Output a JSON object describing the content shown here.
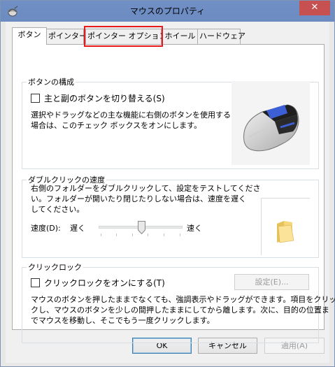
{
  "window": {
    "title": "マウスのプロパティ",
    "close_glyph": "✕"
  },
  "tabs": [
    {
      "label": "ボタン",
      "selected": true
    },
    {
      "label": "ポインター"
    },
    {
      "label": "ポインター オプション",
      "highlighted": true
    },
    {
      "label": "ホイール"
    },
    {
      "label": "ハードウェア"
    }
  ],
  "button_config": {
    "legend": "ボタンの構成",
    "checkbox_label": "主と副のボタンを切り替える(S)",
    "checked": false,
    "desc_line1": "選択やドラッグなどの主な機能に右側のボタンを使用する",
    "desc_line2": "場合は、このチェック ボックスをオンにします。",
    "image": "mouse-icon"
  },
  "double_click": {
    "legend": "ダブルクリックの速度",
    "desc_line1": "右側のフォルダーをダブルクリックして、設定をテストしてくださ",
    "desc_line2": "い。フォルダーが開いたり閉じたりしない場合は、速度を遅く",
    "desc_line3": "してください。",
    "speed_label": "速度(D):",
    "slow_label": "遅く",
    "fast_label": "速く",
    "speed_value": 0.5,
    "test_icon": "folder-icon"
  },
  "click_lock": {
    "legend": "クリックロック",
    "checkbox_label": "クリックロックをオンにする(T)",
    "checked": false,
    "settings_button": "設定(E)...",
    "desc_line1": "マウスのボタンを押したままでなくても、強調表示やドラッグができます。項目をクリッ",
    "desc_line2": "クし、マウスのボタンを少しの間押したままにしてから離します。次に、目的の位置ま",
    "desc_line3": "でマウスを移動し、そこでもう一度クリックします。"
  },
  "footer": {
    "ok": "OK",
    "cancel": "キャンセル",
    "apply": "適用(A)"
  },
  "colors": {
    "title_bar": "#6f8fc5",
    "close_button": "#c75050",
    "highlight_box": "#e8191a"
  }
}
